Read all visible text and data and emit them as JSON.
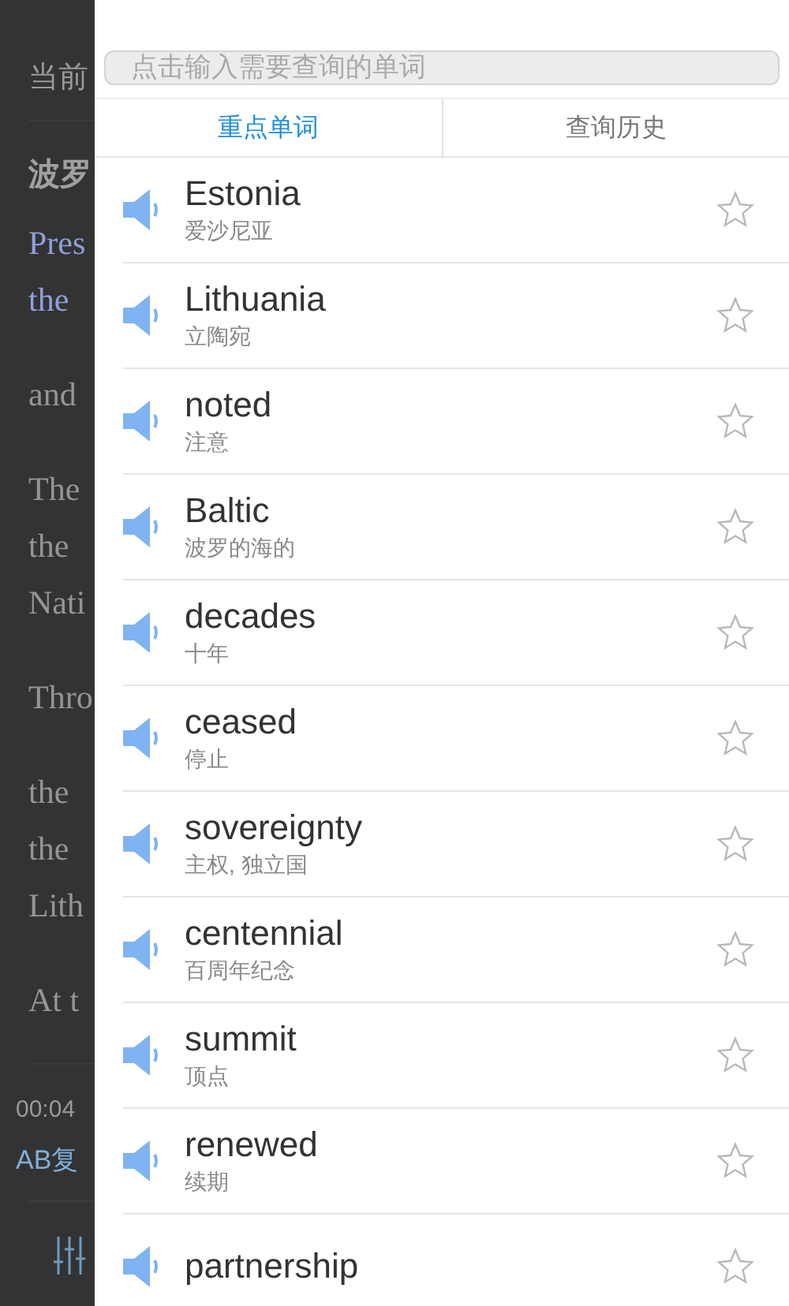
{
  "background": {
    "header_label": "当前",
    "title": "波罗",
    "paragraphs": [
      {
        "kind": "link",
        "lines": [
          "Pres",
          "the"
        ]
      },
      {
        "kind": "text",
        "lines": [
          "and"
        ]
      },
      {
        "kind": "text",
        "lines": [
          "The",
          "the",
          "Nati"
        ]
      },
      {
        "kind": "text",
        "lines": [
          "Thro"
        ]
      },
      {
        "kind": "text",
        "lines": [
          "the",
          "the",
          "Lith"
        ]
      },
      {
        "kind": "text",
        "lines": [
          "At t"
        ]
      }
    ],
    "player": {
      "time": "00:04",
      "repeat": "AB复"
    }
  },
  "drawer": {
    "search": {
      "placeholder": "点击输入需要查询的单词"
    },
    "tabs": [
      {
        "label": "重点单词",
        "selected": true
      },
      {
        "label": "查询历史",
        "selected": false
      }
    ],
    "words": [
      {
        "word": "Estonia",
        "meaning": "爱沙尼亚",
        "starred": false
      },
      {
        "word": "Lithuania",
        "meaning": "立陶宛",
        "starred": false
      },
      {
        "word": "noted",
        "meaning": "注意",
        "starred": false
      },
      {
        "word": "Baltic",
        "meaning": "波罗的海的",
        "starred": false
      },
      {
        "word": "decades",
        "meaning": "十年",
        "starred": false
      },
      {
        "word": "ceased",
        "meaning": "停止",
        "starred": false
      },
      {
        "word": "sovereignty",
        "meaning": "主权, 独立国",
        "starred": false
      },
      {
        "word": "centennial",
        "meaning": "百周年纪念",
        "starred": false
      },
      {
        "word": "summit",
        "meaning": "顶点",
        "starred": false
      },
      {
        "word": "renewed",
        "meaning": "续期",
        "starred": false
      },
      {
        "word": "partnership",
        "starred": false
      }
    ]
  }
}
